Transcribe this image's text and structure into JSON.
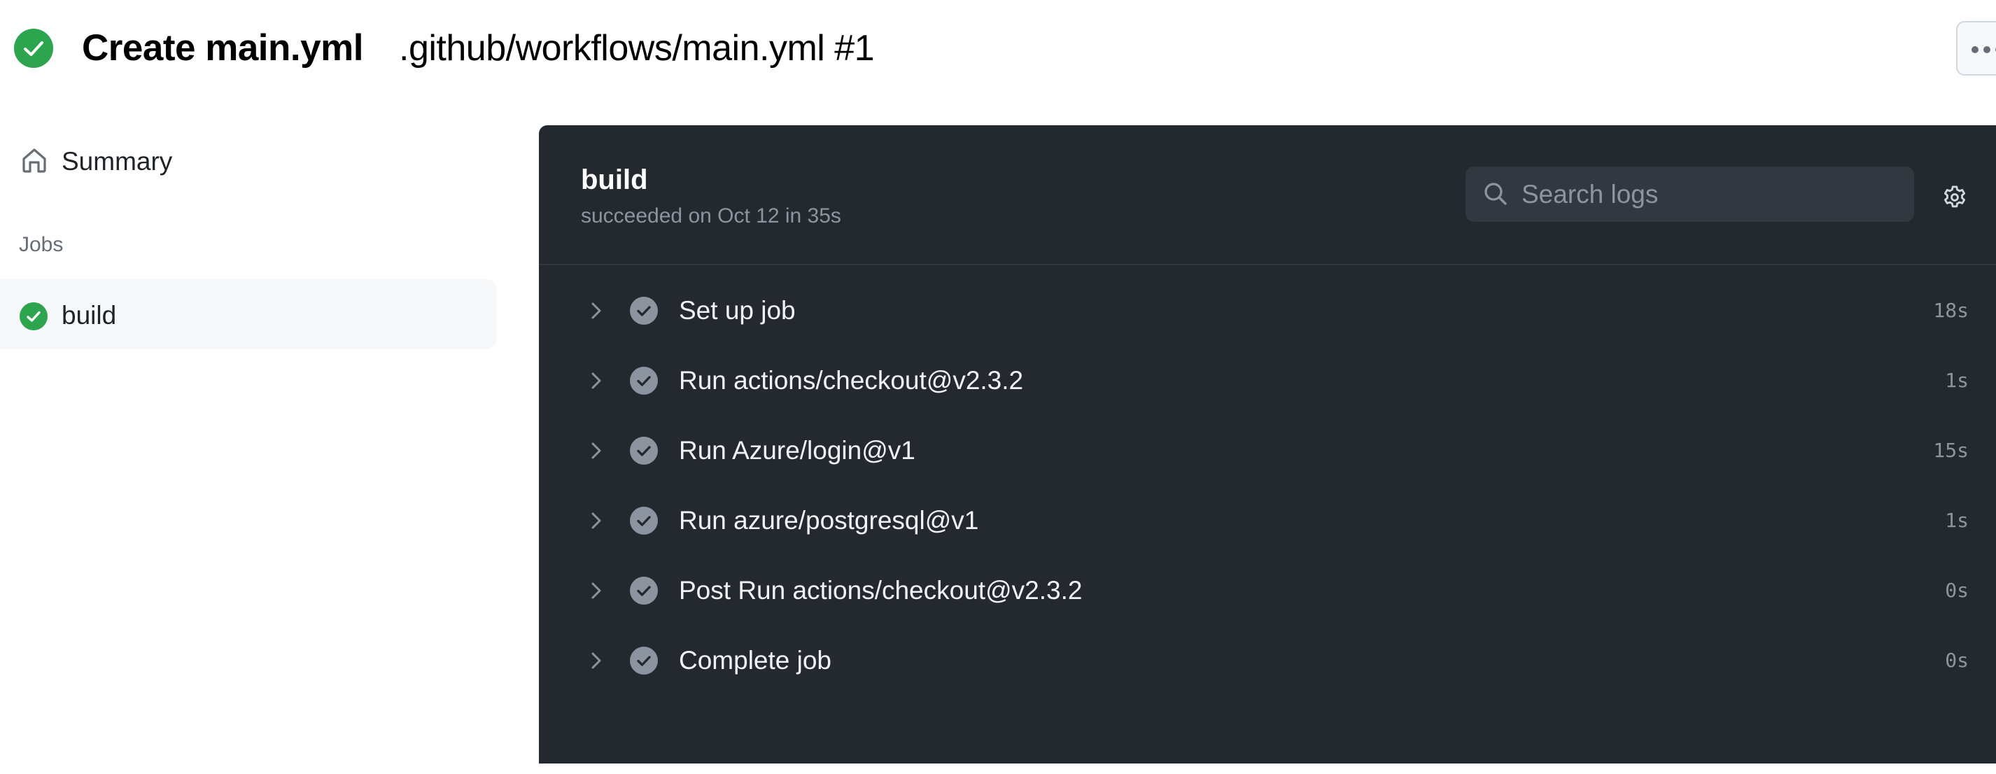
{
  "header": {
    "status_icon": "check-circle-fill-icon",
    "status_color": "#2da44e",
    "title": "Create main.yml",
    "subtitle": ".github/workflows/main.yml #1",
    "more_menu_icon": "kebab-horizontal-icon"
  },
  "sidebar": {
    "summary": {
      "label": "Summary",
      "icon": "home-icon"
    },
    "jobs_heading": "Jobs",
    "jobs": [
      {
        "label": "build",
        "status": "success",
        "icon": "check-circle-fill-icon",
        "selected": true
      }
    ]
  },
  "panel": {
    "job_title": "build",
    "job_status": "succeeded on Oct 12 in 35s",
    "search": {
      "placeholder": "Search logs",
      "value": "",
      "icon": "search-icon"
    },
    "settings_icon": "gear-icon",
    "colors": {
      "background": "#24292f",
      "step_check": "#8c959f"
    },
    "steps": [
      {
        "name": "Set up job",
        "duration": "18s"
      },
      {
        "name": "Run actions/checkout@v2.3.2",
        "duration": "1s"
      },
      {
        "name": "Run Azure/login@v1",
        "duration": "15s"
      },
      {
        "name": "Run azure/postgresql@v1",
        "duration": "1s"
      },
      {
        "name": "Post Run actions/checkout@v2.3.2",
        "duration": "0s"
      },
      {
        "name": "Complete job",
        "duration": "0s"
      }
    ]
  }
}
